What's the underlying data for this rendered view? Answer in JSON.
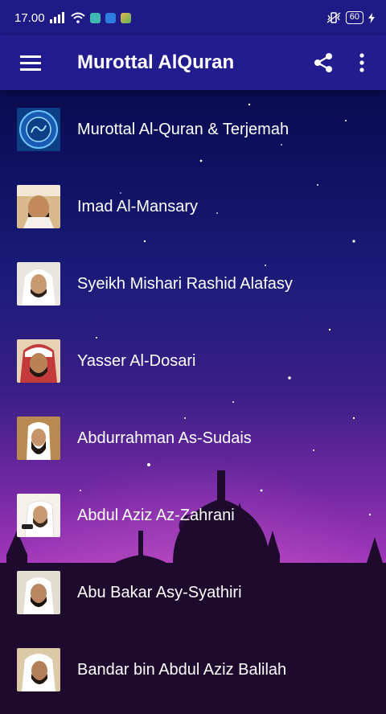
{
  "status_bar": {
    "time": "17.00",
    "battery": "60",
    "icons": [
      "signal-icon",
      "wifi-icon",
      "shield-app-icon",
      "vpn-app-icon",
      "gallery-app-icon",
      "vibrate-icon",
      "charging-icon"
    ]
  },
  "app_bar": {
    "title": "Murottal AlQuran",
    "menu_icon": "hamburger-menu-icon",
    "share_icon": "share-icon",
    "more_icon": "more-vert-icon"
  },
  "reciters": [
    {
      "label": "Murottal Al-Quran & Terjemah"
    },
    {
      "label": "Imad Al-Mansary"
    },
    {
      "label": "Syeikh Mishari Rashid Alafasy"
    },
    {
      "label": "Yasser Al-Dosari"
    },
    {
      "label": "Abdurrahman As-Sudais"
    },
    {
      "label": "Abdul Aziz Az-Zahrani"
    },
    {
      "label": "Abu Bakar Asy-Syathiri"
    },
    {
      "label": "Bandar bin Abdul Aziz Balilah"
    }
  ],
  "colors": {
    "app_bar": "#221c8e",
    "status_bar": "#1f1b86",
    "text": "#ffffff"
  }
}
